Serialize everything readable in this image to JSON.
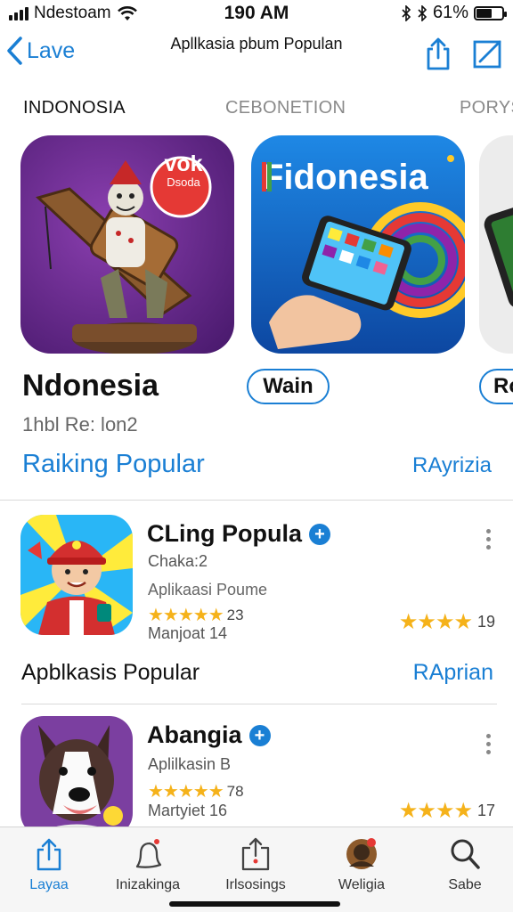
{
  "status_bar": {
    "carrier": "Ndestoam",
    "time": "190 AM",
    "battery": "61%",
    "battery_level": 0.61
  },
  "nav": {
    "back_label": "Lave",
    "title": "Apllkasia pbum Populan",
    "icons": [
      "share-icon",
      "edit-icon"
    ]
  },
  "tabs": [
    {
      "label": "INDONOSIA",
      "active": true
    },
    {
      "label": "CEBONETION",
      "active": false
    },
    {
      "label": "PORYS",
      "active": false
    }
  ],
  "featured": [
    {
      "name": "Ndonesia",
      "subtitle": "1hbl Re: lon2",
      "rank_label": "Raiking Popular",
      "badge_line1": "vok",
      "badge_line2": "Dsoda"
    },
    {
      "banner": "Fidonesia",
      "button": "Wain",
      "rank_label": "RAyrizia"
    },
    {
      "button": "Ro"
    }
  ],
  "apps": [
    {
      "name": "CLing Popula",
      "line1": "Chaka:2",
      "line2": "Aplikaasi Poume",
      "rating_count": "23",
      "meta": "Manjoat 14",
      "right_rating": "19"
    },
    {
      "name": "Abangia",
      "line1": "Aplilkasin B",
      "rating_count": "78",
      "meta": "Martyiet 16",
      "right_rating": "17"
    }
  ],
  "section": {
    "title": "Apblkasis Popular",
    "link": "RAprian"
  },
  "tab_bar": [
    {
      "label": "Layaa",
      "icon": "share-icon",
      "active": true
    },
    {
      "label": "Inizakinga",
      "icon": "bell-icon",
      "active": false
    },
    {
      "label": "Irlsosings",
      "icon": "upload-box-icon",
      "active": false
    },
    {
      "label": "Weligia",
      "icon": "avatar-icon",
      "active": false
    },
    {
      "label": "Sabe",
      "icon": "search-icon",
      "active": false
    }
  ],
  "colors": {
    "accent": "#1a7fd4",
    "star": "#f5b21a",
    "purple": "#6a2a8c",
    "blue_card": "#1565c0"
  }
}
